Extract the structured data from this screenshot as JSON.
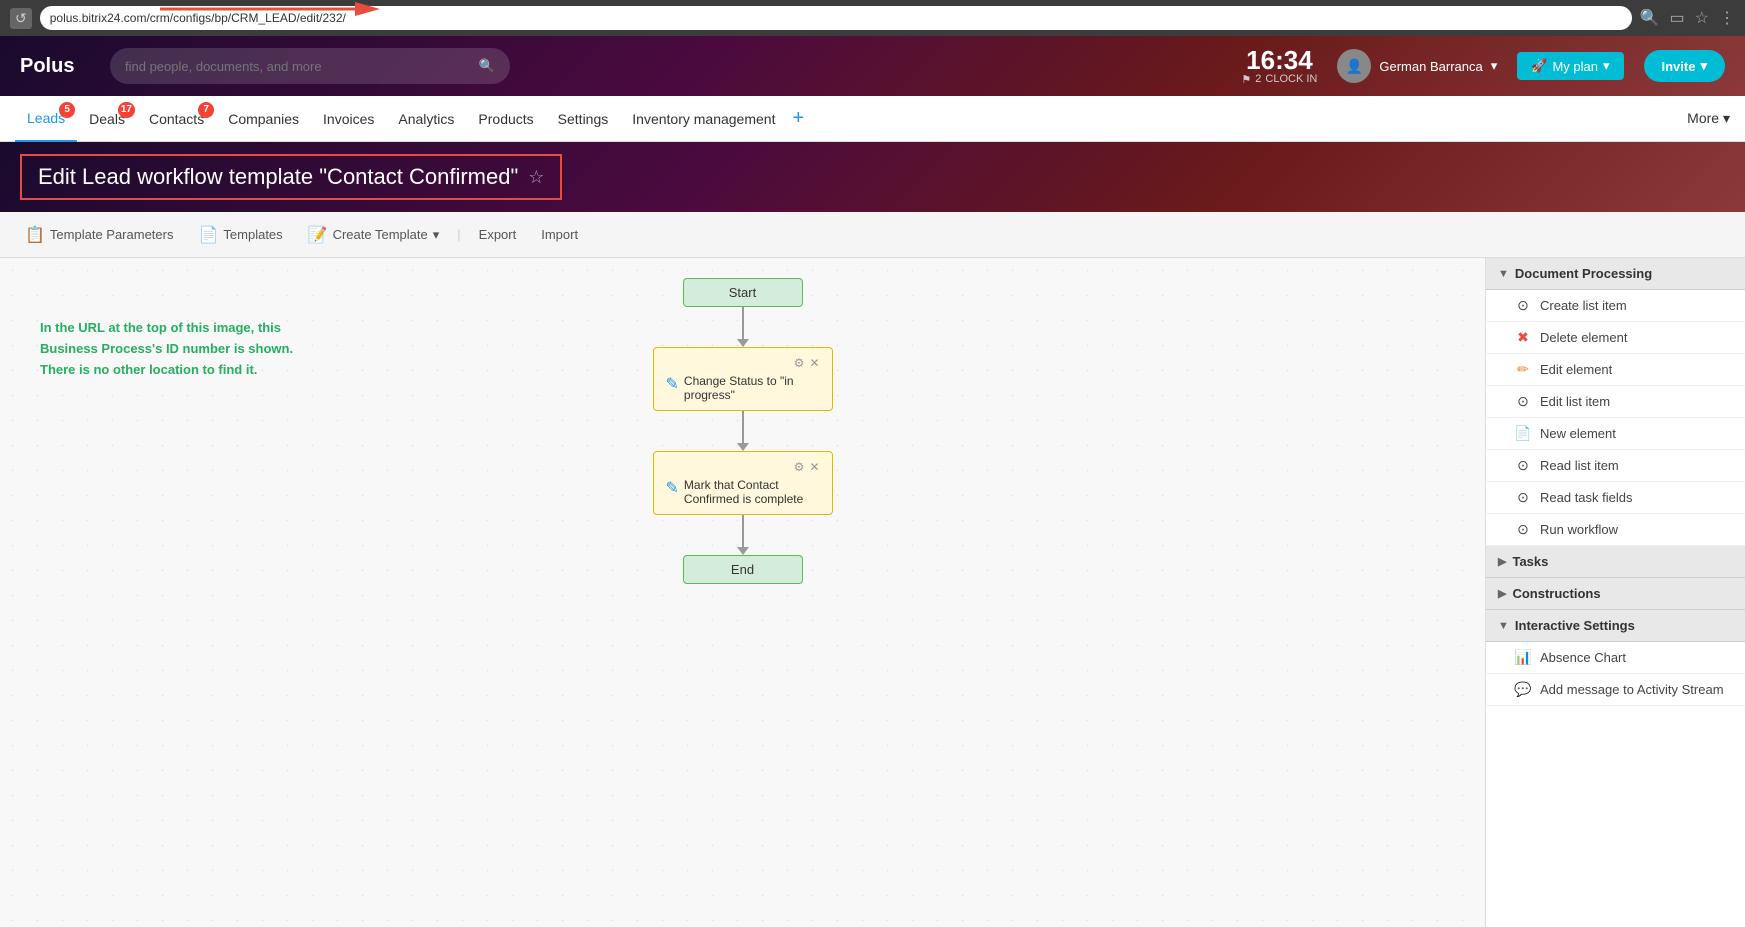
{
  "browser": {
    "url": "polus.bitrix24.com/crm/configs/bp/CRM_LEAD/edit/232/",
    "url_short": "polus.bitrix24.com/crm/configs/bp/CRM_LEAD/edit/232/"
  },
  "header": {
    "logo": "Polus",
    "search_placeholder": "find people, documents, and more",
    "time": "16:34",
    "clock_label": "CLOCK IN",
    "notifications_count": "2",
    "user_name": "German Barranca",
    "my_plan_label": "My plan",
    "invite_label": "Invite"
  },
  "nav": {
    "items": [
      {
        "label": "Leads",
        "badge": "5",
        "active": true
      },
      {
        "label": "Deals",
        "badge": "17",
        "active": false
      },
      {
        "label": "Contacts",
        "badge": "7",
        "active": false
      },
      {
        "label": "Companies",
        "badge": "",
        "active": false
      },
      {
        "label": "Invoices",
        "badge": "",
        "active": false
      },
      {
        "label": "Analytics",
        "badge": "",
        "active": false
      },
      {
        "label": "Products",
        "badge": "",
        "active": false
      },
      {
        "label": "Settings",
        "badge": "",
        "active": false
      },
      {
        "label": "Inventory management",
        "badge": "",
        "active": false
      }
    ],
    "more_label": "More"
  },
  "page_title": "Edit Lead workflow template \"Contact Confirmed\"",
  "toolbar": {
    "template_parameters_label": "Template Parameters",
    "templates_label": "Templates",
    "create_template_label": "Create Template",
    "export_label": "Export",
    "import_label": "Import"
  },
  "annotation": {
    "line1": "In the URL at the top of this image, this",
    "line2": "Business Process's ID number is shown.",
    "line3": "There is no other location to find it."
  },
  "workflow": {
    "start_label": "Start",
    "end_label": "End",
    "action1_label": "Change Status to \"in progress\"",
    "action2_label": "Mark that Contact Confirmed is complete"
  },
  "sidebar": {
    "sections": [
      {
        "id": "document_processing",
        "label": "Document Processing",
        "expanded": true,
        "items": [
          {
            "label": "Create list item",
            "icon": "⊙"
          },
          {
            "label": "Delete element",
            "icon": "✖"
          },
          {
            "label": "Edit element",
            "icon": "✏"
          },
          {
            "label": "Edit list item",
            "icon": "⊙"
          },
          {
            "label": "New element",
            "icon": "📄"
          },
          {
            "label": "Read list item",
            "icon": "⊙"
          },
          {
            "label": "Read task fields",
            "icon": "⊙"
          },
          {
            "label": "Run workflow",
            "icon": "⊙"
          }
        ]
      },
      {
        "id": "tasks",
        "label": "Tasks",
        "expanded": false,
        "items": []
      },
      {
        "id": "constructions",
        "label": "Constructions",
        "expanded": false,
        "items": []
      },
      {
        "id": "interactive_settings",
        "label": "Interactive Settings",
        "expanded": true,
        "items": [
          {
            "label": "Absence Chart",
            "icon": "📊"
          },
          {
            "label": "Add message to Activity Stream",
            "icon": "💬"
          }
        ]
      }
    ]
  }
}
